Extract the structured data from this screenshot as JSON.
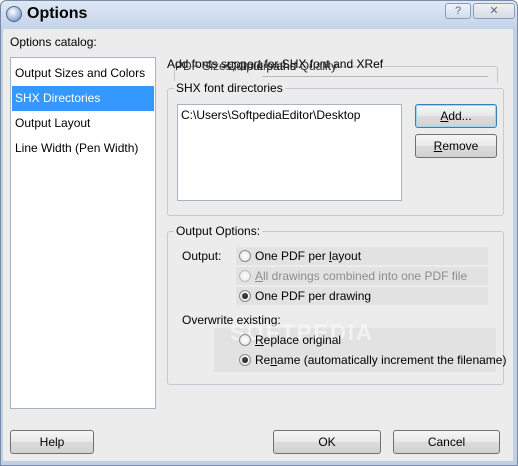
{
  "window": {
    "title": "Options",
    "icon": "options-app-icon"
  },
  "titlebar_buttons": {
    "help": "?",
    "close": "✕"
  },
  "catalog": {
    "label": "Options catalog:",
    "items": [
      "Output Sizes and Colors",
      "SHX Directories",
      "Output Layout",
      "Line Width (Pen Width)"
    ],
    "selected": "SHX Directories"
  },
  "ghost_text": {
    "line1": "Add fonts support for SHX font and XRef",
    "line2": "PDF Sizes, Colors and Quality",
    "line3": "Output paths"
  },
  "shx": {
    "group_label": "SHX font directories",
    "directories": [
      "C:\\Users\\SoftpediaEditor\\Desktop"
    ],
    "add_pre": "",
    "add_accel": "A",
    "add_post": "dd...",
    "remove_pre": "",
    "remove_accel": "R",
    "remove_post": "emove"
  },
  "output_options": {
    "group_label": "Output Options:",
    "output_label": "Output:",
    "opt1_pre": "One PDF per ",
    "opt1_accel": "l",
    "opt1_post": "ayout",
    "opt2_pre": "",
    "opt2_accel": "A",
    "opt2_post": "ll drawings combined into one PDF file",
    "opt3_pre": "One PDF per drawing",
    "opt3_accel": "",
    "opt3_post": "",
    "selected_output": "One PDF per drawing",
    "overwrite_label": "Overwrite existing:",
    "ow1_pre": "",
    "ow1_accel": "R",
    "ow1_post": "eplace original",
    "ow2_pre": "Re",
    "ow2_accel": "n",
    "ow2_post": "ame (automatically increment the filename)",
    "selected_overwrite": "Rename (automatically increment the filename)"
  },
  "watermark": "SOFTPEDIA",
  "footer": {
    "help": "Help",
    "ok": "OK",
    "cancel": "Cancel"
  },
  "colors": {
    "selection": "#3399ff",
    "title_bar": "#c4d3e9",
    "client_bg": "#ececec"
  }
}
